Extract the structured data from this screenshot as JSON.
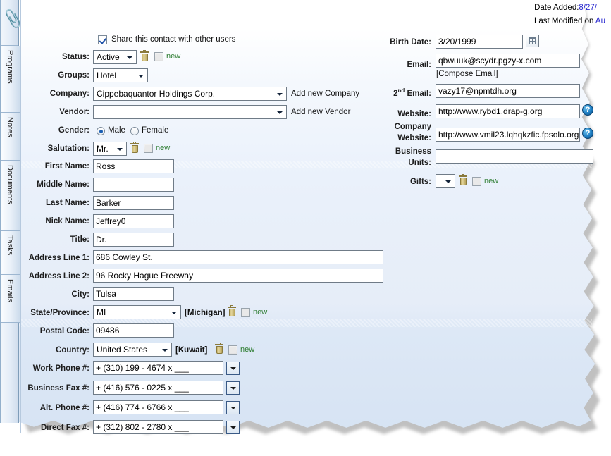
{
  "sidebar": {
    "attachment_icon": "paperclip-icon",
    "tabs": [
      {
        "label": "Programs"
      },
      {
        "label": "Notes"
      },
      {
        "label": "Documents"
      },
      {
        "label": "Tasks"
      },
      {
        "label": "Emails"
      }
    ]
  },
  "header": {
    "date_added_label": "Date Added:",
    "date_added_value": "8/27/",
    "last_modified_label": "Last Modified on ",
    "last_modified_value": "Au"
  },
  "form": {
    "share_checkbox_label": "Share this contact with other users",
    "share_checked": true,
    "new_label": "new",
    "status": {
      "label": "Status:",
      "value": "Active"
    },
    "groups": {
      "label": "Groups:",
      "value": "Hotel"
    },
    "company": {
      "label": "Company:",
      "value": "Cippebaquantor Holdings Corp.",
      "add_link": "Add new Company"
    },
    "vendor": {
      "label": "Vendor:",
      "value": "",
      "add_link": "Add new Vendor"
    },
    "gender": {
      "label": "Gender:",
      "male": "Male",
      "female": "Female",
      "selected": "Male"
    },
    "salutation": {
      "label": "Salutation:",
      "value": "Mr."
    },
    "first_name": {
      "label": "First Name:",
      "value": "Ross"
    },
    "middle_name": {
      "label": "Middle Name:",
      "value": ""
    },
    "last_name": {
      "label": "Last Name:",
      "value": "Barker"
    },
    "nick_name": {
      "label": "Nick Name:",
      "value": "Jeffrey0"
    },
    "title": {
      "label": "Title:",
      "value": "Dr."
    },
    "address1": {
      "label": "Address Line 1:",
      "value": "686 Cowley St."
    },
    "address2": {
      "label": "Address Line 2:",
      "value": "96 Rocky Hague Freeway"
    },
    "city": {
      "label": "City:",
      "value": "Tulsa"
    },
    "state": {
      "label": "State/Province:",
      "value": "MI",
      "bracket": "[Michigan]"
    },
    "postal": {
      "label": "Postal Code:",
      "value": "09486"
    },
    "country": {
      "label": "Country:",
      "value": "United States",
      "bracket": "[Kuwait]"
    },
    "work_phone": {
      "label": "Work Phone #:",
      "value": "+ (310) 199 - 4674 x ___"
    },
    "business_fax": {
      "label": "Business Fax #:",
      "value": "+ (416) 576 - 0225 x ___"
    },
    "alt_phone": {
      "label": "Alt. Phone #:",
      "value": "+ (416) 774 - 6766 x ___"
    },
    "direct_fax": {
      "label": "Direct Fax #:",
      "value": "+ (312) 802 - 2780 x ___"
    },
    "birth_date": {
      "label": "Birth Date:",
      "value": "3/20/1999"
    },
    "email": {
      "label": "Email:",
      "value": "qbwuuk@scydr.pgzy-x.com",
      "compose_link": "[Compose Email]"
    },
    "email2": {
      "label_pre": "2",
      "label_sup": "nd",
      "label_post": " Email:",
      "value": "vazy17@npmtdh.org"
    },
    "website": {
      "label": "Website:",
      "value": "http://www.rybd1.drap-g.org"
    },
    "company_website": {
      "label_line1": "Company",
      "label_line2": "Website:",
      "value": "http://www.vmil23.lqhqkzfic.fpsolo.org"
    },
    "business_units": {
      "label_line1": "Business",
      "label_line2": "Units:",
      "value": ""
    },
    "gifts": {
      "label": "Gifts:",
      "value": ""
    },
    "help_icon_glyph": "?"
  },
  "colors": {
    "accent_blue": "#2a2ad0",
    "new_green": "#2e7d32",
    "field_border": "#6f7b87",
    "page_blue": "#dde8f6"
  }
}
